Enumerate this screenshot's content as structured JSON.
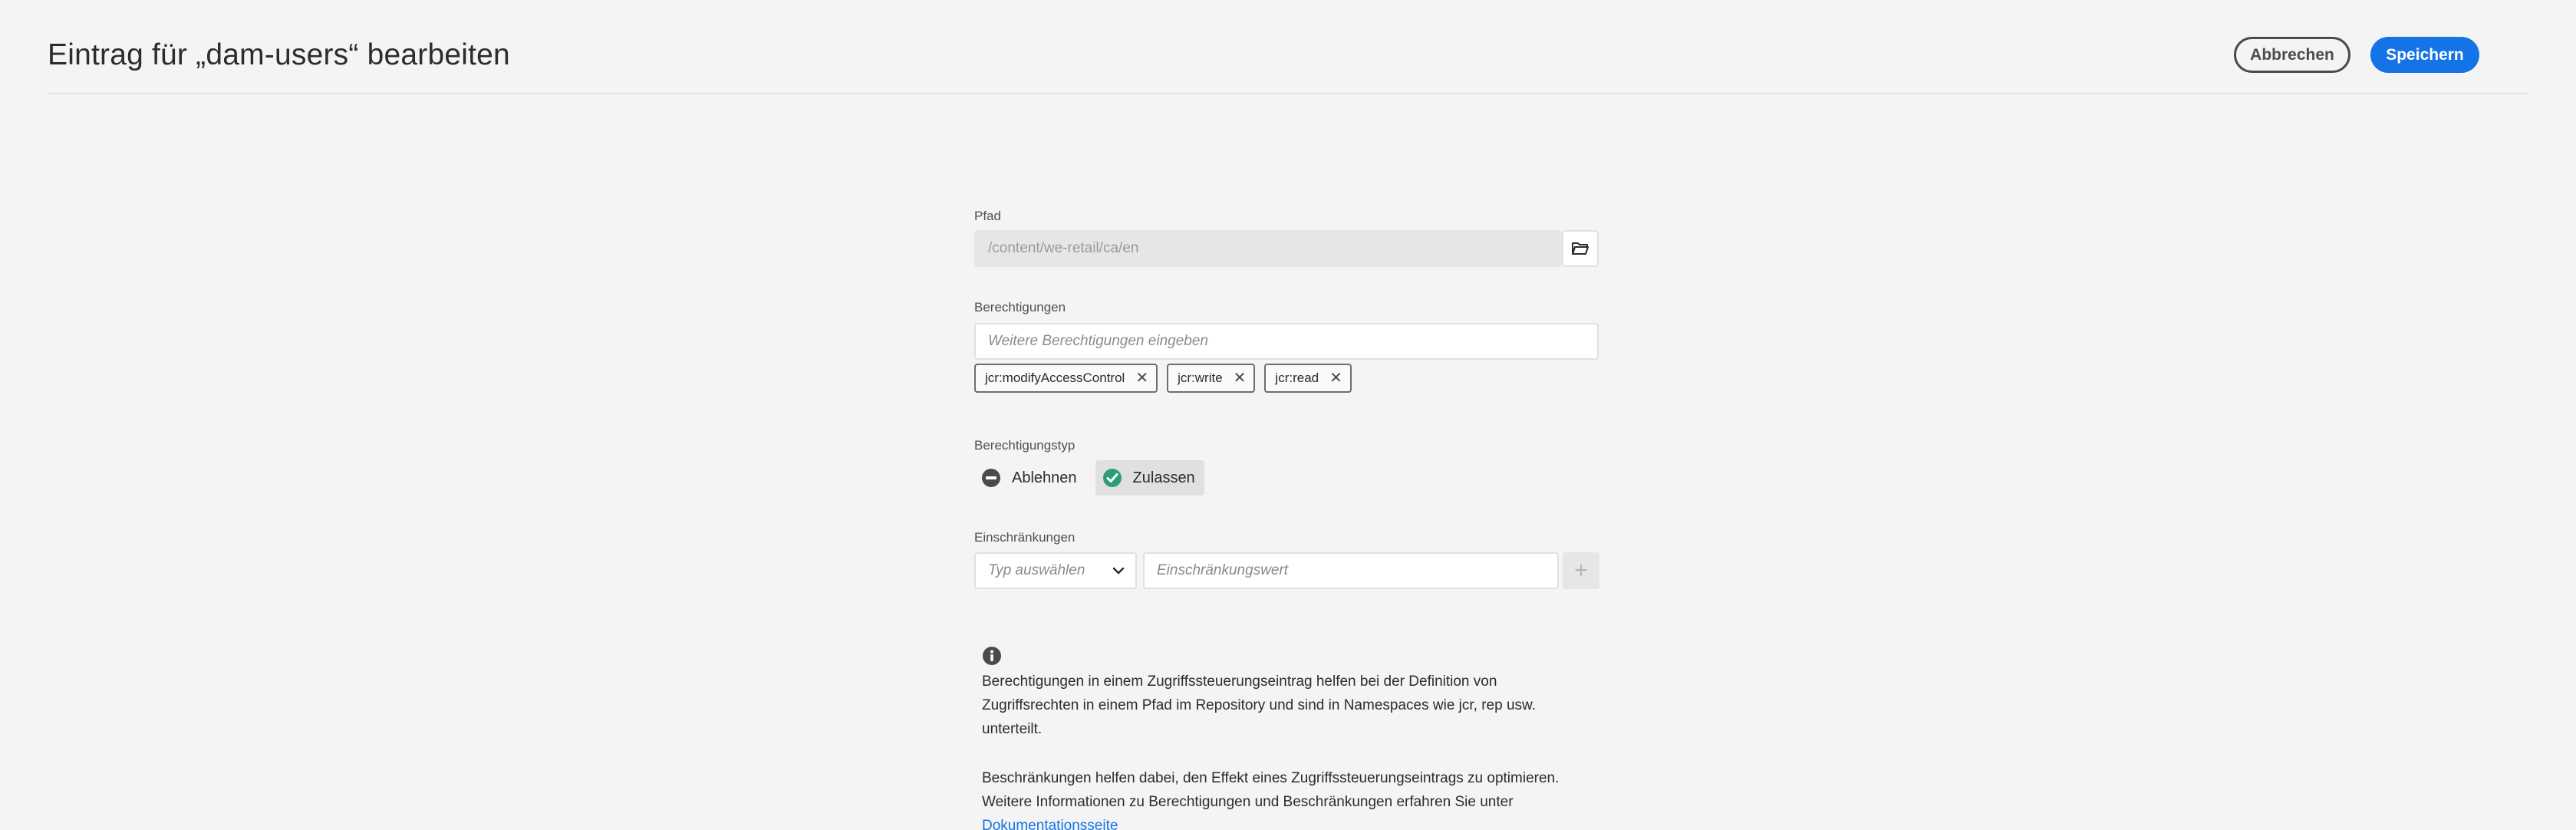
{
  "header": {
    "title": "Eintrag für „dam-users“ bearbeiten",
    "cancel_label": "Abbrechen",
    "save_label": "Speichern"
  },
  "path": {
    "label": "Pfad",
    "value": "/content/we-retail/ca/en"
  },
  "permissions": {
    "label": "Berechtigungen",
    "placeholder": "Weitere Berechtigungen eingeben",
    "tags": [
      "jcr:modifyAccessControl",
      "jcr:write",
      "jcr:read"
    ]
  },
  "permission_type": {
    "label": "Berechtigungstyp",
    "options": [
      {
        "label": "Ablehnen",
        "selected": false
      },
      {
        "label": "Zulassen",
        "selected": true
      }
    ]
  },
  "restrictions": {
    "label": "Einschränkungen",
    "type_placeholder": "Typ auswählen",
    "value_placeholder": "Einschränkungswert"
  },
  "info": {
    "paragraph1_lines": [
      "Berechtigungen in einem Zugriffssteuerungseintrag helfen bei der Definition von",
      "Zugriffsrechten in einem Pfad im Repository und sind in Namespaces wie jcr, rep usw.",
      "unterteilt."
    ],
    "paragraph2_lines": [
      "Beschränkungen helfen dabei, den Effekt eines Zugriffssteuerungseintrags zu optimieren.",
      "Weitere Informationen zu Berechtigungen und Beschränkungen erfahren Sie unter"
    ],
    "link_text": "Dokumentationsseite"
  },
  "colors": {
    "accent": "#1473e6",
    "allow_green": "#2d9d78",
    "background": "#f4f4f4"
  }
}
